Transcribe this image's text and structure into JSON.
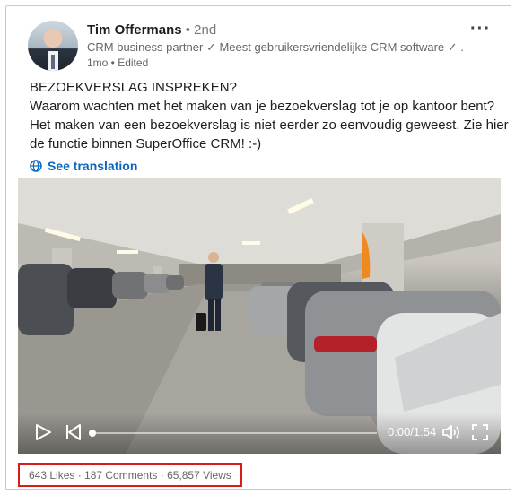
{
  "post": {
    "author_name": "Tim Offermans",
    "degree": " • 2nd",
    "headline": "CRM business partner ✓ Meest gebruikersvriendelijke CRM software ✓ ...",
    "time_meta": "1mo • Edited",
    "more_label": "···",
    "body_lines": [
      "BEZOEKVERSLAG INSPREKEN?",
      "Waarom wachten met het maken van je bezoekverslag tot je op kantoor bent?",
      "Het maken van een bezoekverslag is niet eerder zo eenvoudig geweest. Zie hier",
      "de functie binnen SuperOffice CRM! :-)"
    ],
    "translate_label": "See translation"
  },
  "video": {
    "time_label": "0:00/1:54",
    "progress": 0
  },
  "stats": {
    "text": "643 Likes · 187 Comments · 65,857 Views"
  },
  "colors": {
    "link": "#0a66c2",
    "highlight_border": "#d81b1b"
  },
  "icons": [
    "globe-icon",
    "play-icon",
    "skip-back-icon",
    "volume-icon",
    "fullscreen-icon",
    "more-icon"
  ]
}
